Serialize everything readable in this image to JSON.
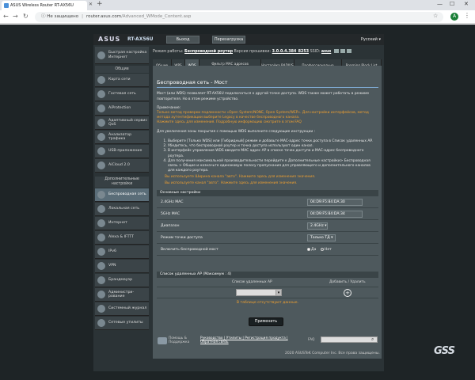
{
  "browser": {
    "tab_title": "ASUS Wireless Router RT-AX56U",
    "security_label": "Не защищено",
    "url_host": "router.asus.com",
    "url_path": "/Advanced_WMode_Content.asp"
  },
  "router": {
    "logo": "ASUS",
    "model": "RT-AX56U",
    "logout_label": "Выход",
    "reboot_label": "Перезагрузка",
    "language": "Русский",
    "status": {
      "mode_label": "Режим работы:",
      "mode_value": "Беспроводной роутер",
      "fw_label": "Версия прошивки:",
      "fw_value": "3.0.0.4.384_8253",
      "ssid_label": "SSID:",
      "ssid_value": "asus"
    }
  },
  "sidebar": {
    "quick_setup": "Быстрая настройка Интернет",
    "general_header": "Общие",
    "general": [
      "Карта сети",
      "Гостевая сеть",
      "AiProtection",
      "Адаптивный сервис QoS",
      "Анализатор трафика",
      "USB-приложение",
      "AiCloud 2.0"
    ],
    "advanced_header": "Дополнительные настройки",
    "advanced": [
      "Беспроводная сеть",
      "Локальная сеть",
      "Интернет",
      "Alexa & IFTTT",
      "IPv6",
      "VPN",
      "Брандмауэр",
      "Администри-рование",
      "Системный журнал",
      "Сетевые утилиты"
    ]
  },
  "tabs": [
    "Общие",
    "WPS",
    "WDS",
    "Фильтр MAC адресов беспроводной сети",
    "Настройка RADIUS",
    "Профессионально",
    "Roaming Block List"
  ],
  "page": {
    "title": "Беспроводная сеть - Мост",
    "intro": "Мост (или WDS) позволяет RT-AX56U подключаться к другой точке доступа. WDS также может работать в режиме повторителя. Но в этом режиме устройство.",
    "note_header": "Примечание:",
    "note_lines": [
      "Только метод проверки подлинности «Open System/NONE, Open System/WEP». Для настройки интерфейсов, метод",
      "метода аутентификации выберите Legacy в качестве беспроводного канала.",
      "Нажмите здесь для изменения. Подробную информацию смотрите в этом FAQ"
    ],
    "steps_intro": "Для увеличения зоны покрытия с помощью WDS выполните следующие инструкции :",
    "steps": [
      "Выберите [Только WDS] или [Гибридный] режим и добавьте MAC-адрес точки доступа в Список удаленных AP.",
      "Убедитесь, что беспроводной роутер и точка доступа используют один канал.",
      "В интерфейс управления WDS введите MAC адрес AP в списке точек доступа и MAC-адрес беспроводного роутера.",
      "Для получения максимальной производительности перейдите к Дополнительные настройки> Беспроводная связь > Общие и назначьте одинаковую полосу пропускания для управляющего и дополнительного каналов для каждого роутера."
    ],
    "warn1": "Вы используете Ширина канала \"авто\". Нажмите здесь для изменения значения.",
    "warn2": "Вы используете канал \"авто\". Нажмите здесь для изменения значения.",
    "basic_header": "Основные настройки",
    "rows": {
      "mac24_label": "2.4GHz MAC",
      "mac24_value": "04:D9:F5:84:DA:30",
      "mac5_label": "5GHz MAC",
      "mac5_value": "04:D9:F5:84:DA:34",
      "band_label": "Диапазон",
      "band_value": "2.4GHz",
      "ap_mode_label": "Режим точки доступа",
      "ap_mode_value": "Только ТД",
      "bridge_label": "Включить беспроводной мост",
      "yes_label": "Да",
      "no_label": "Нет"
    },
    "remote_header": "Список удаленных AP (Максимум : 4)",
    "remote_col1": "Список удаленных AP",
    "remote_col2": "Добавить / Удалить",
    "empty_msg": "В таблице отсутствуют данные.",
    "apply_label": "Применить"
  },
  "footer": {
    "help": "Помощь & Поддержка",
    "links": "Руководство | Утилиты | Регистрация продукта | Обратная связь",
    "faq": "FAQ"
  },
  "copyright": "2020 ASUSTeK Computer Inc. Все права защищены.",
  "watermark": "GSS"
}
